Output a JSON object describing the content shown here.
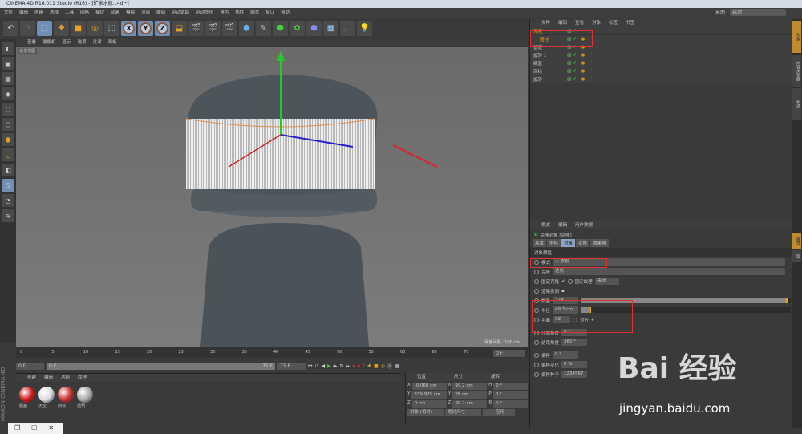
{
  "title": "CINEMA 4D R16.011 Studio (R16) - [矿泉水瓶.c4d *]",
  "menu": [
    "文件",
    "编辑",
    "创建",
    "选择",
    "工具",
    "网格",
    "捕捉",
    "动画",
    "模拟",
    "渲染",
    "雕刻",
    "运动跟踪",
    "运动图形",
    "角色",
    "插件",
    "脚本",
    "窗口",
    "帮助"
  ],
  "layout_label": "界面:",
  "layout_value": "启动",
  "viewport": {
    "menu": [
      "查看",
      "摄像机",
      "显示",
      "选项",
      "过滤",
      "面板"
    ],
    "label": "透视视图",
    "scale": "网格间距 : 100 cm"
  },
  "outliner": {
    "menu": [
      "文件",
      "编辑",
      "查看",
      "对象",
      "标签",
      "书签"
    ],
    "items": [
      {
        "name": "克隆"
      },
      {
        "name": "圆柱"
      },
      {
        "name": "管道"
      },
      {
        "name": "旋转 1"
      },
      {
        "name": "瓶盖"
      },
      {
        "name": "商标"
      },
      {
        "name": "旋转"
      }
    ]
  },
  "attributes": {
    "menu": [
      "模式",
      "编辑",
      "用户数据"
    ],
    "object_title": "克隆对象 [克隆]",
    "tabs": [
      "基本",
      "坐标",
      "对象",
      "变换",
      "效果器"
    ],
    "section": "对象属性",
    "mode_label": "模式",
    "mode_value": "放射",
    "clones_label": "克隆",
    "clones_value": "迭代",
    "fix_clone_label": "固定克隆",
    "fix_texture_label": "固定纹理",
    "fix_texture_value": "关闭",
    "render_instance_label": "渲染实例",
    "count_label": "数量",
    "count_value": "324",
    "count_fraction": 0.99,
    "radius_label": "半径",
    "radius_value": "49.3 cm",
    "radius_fraction": 0.05,
    "plane_label": "平面",
    "plane_value": "XZ",
    "align_label": "对齐",
    "start_angle_label": "开始角度",
    "start_angle_value": "0 °",
    "end_angle_label": "结束角度",
    "end_angle_value": "360 °",
    "offset_label": "偏移",
    "offset_value": "0 °",
    "offset_var_label": "偏移变化",
    "offset_var_value": "0 %",
    "offset_seed_label": "偏移种子",
    "offset_seed_value": "1234567"
  },
  "side_tabs": [
    "对象",
    "内容浏览器",
    "构造"
  ],
  "side_tabs2": [
    "属性",
    "层"
  ],
  "timeline": {
    "ticks": [
      "0",
      "5",
      "10",
      "15",
      "20",
      "25",
      "30",
      "35",
      "40",
      "45",
      "50",
      "55",
      "60",
      "65",
      "70",
      "75"
    ],
    "current": "0 F",
    "start": "0 F",
    "range_start": "0 F",
    "range_end": "75 F",
    "end": "75 F"
  },
  "materials": {
    "menu": [
      "创建",
      "编辑",
      "功能",
      "纹理"
    ],
    "items": [
      {
        "name": "瓶盖",
        "color": "#cc1a1a"
      },
      {
        "name": "天空",
        "color": "#dddddd"
      },
      {
        "name": "商标",
        "color": "#c83030"
      },
      {
        "name": "透明",
        "color": "#aaaaaa"
      }
    ]
  },
  "coords": {
    "headers": [
      "位置",
      "尺寸",
      "旋转"
    ],
    "rows": [
      [
        "X",
        "-0.068 cm",
        "X",
        "99.2 cm",
        "H",
        "0 °"
      ],
      [
        "Y",
        "339.975 cm",
        "Y",
        "28 cm",
        "P",
        "0 °"
      ],
      [
        "Z",
        "0 cm",
        "Z",
        "99.2 cm",
        "B",
        "0 °"
      ]
    ],
    "mode": "对象 (相对)",
    "size_mode": "绝对尺寸",
    "apply": "应用"
  },
  "watermark": {
    "text": "Bai 经验",
    "url": "jingyan.baidu.com"
  },
  "brand": "MAXON CINEMA 4D"
}
